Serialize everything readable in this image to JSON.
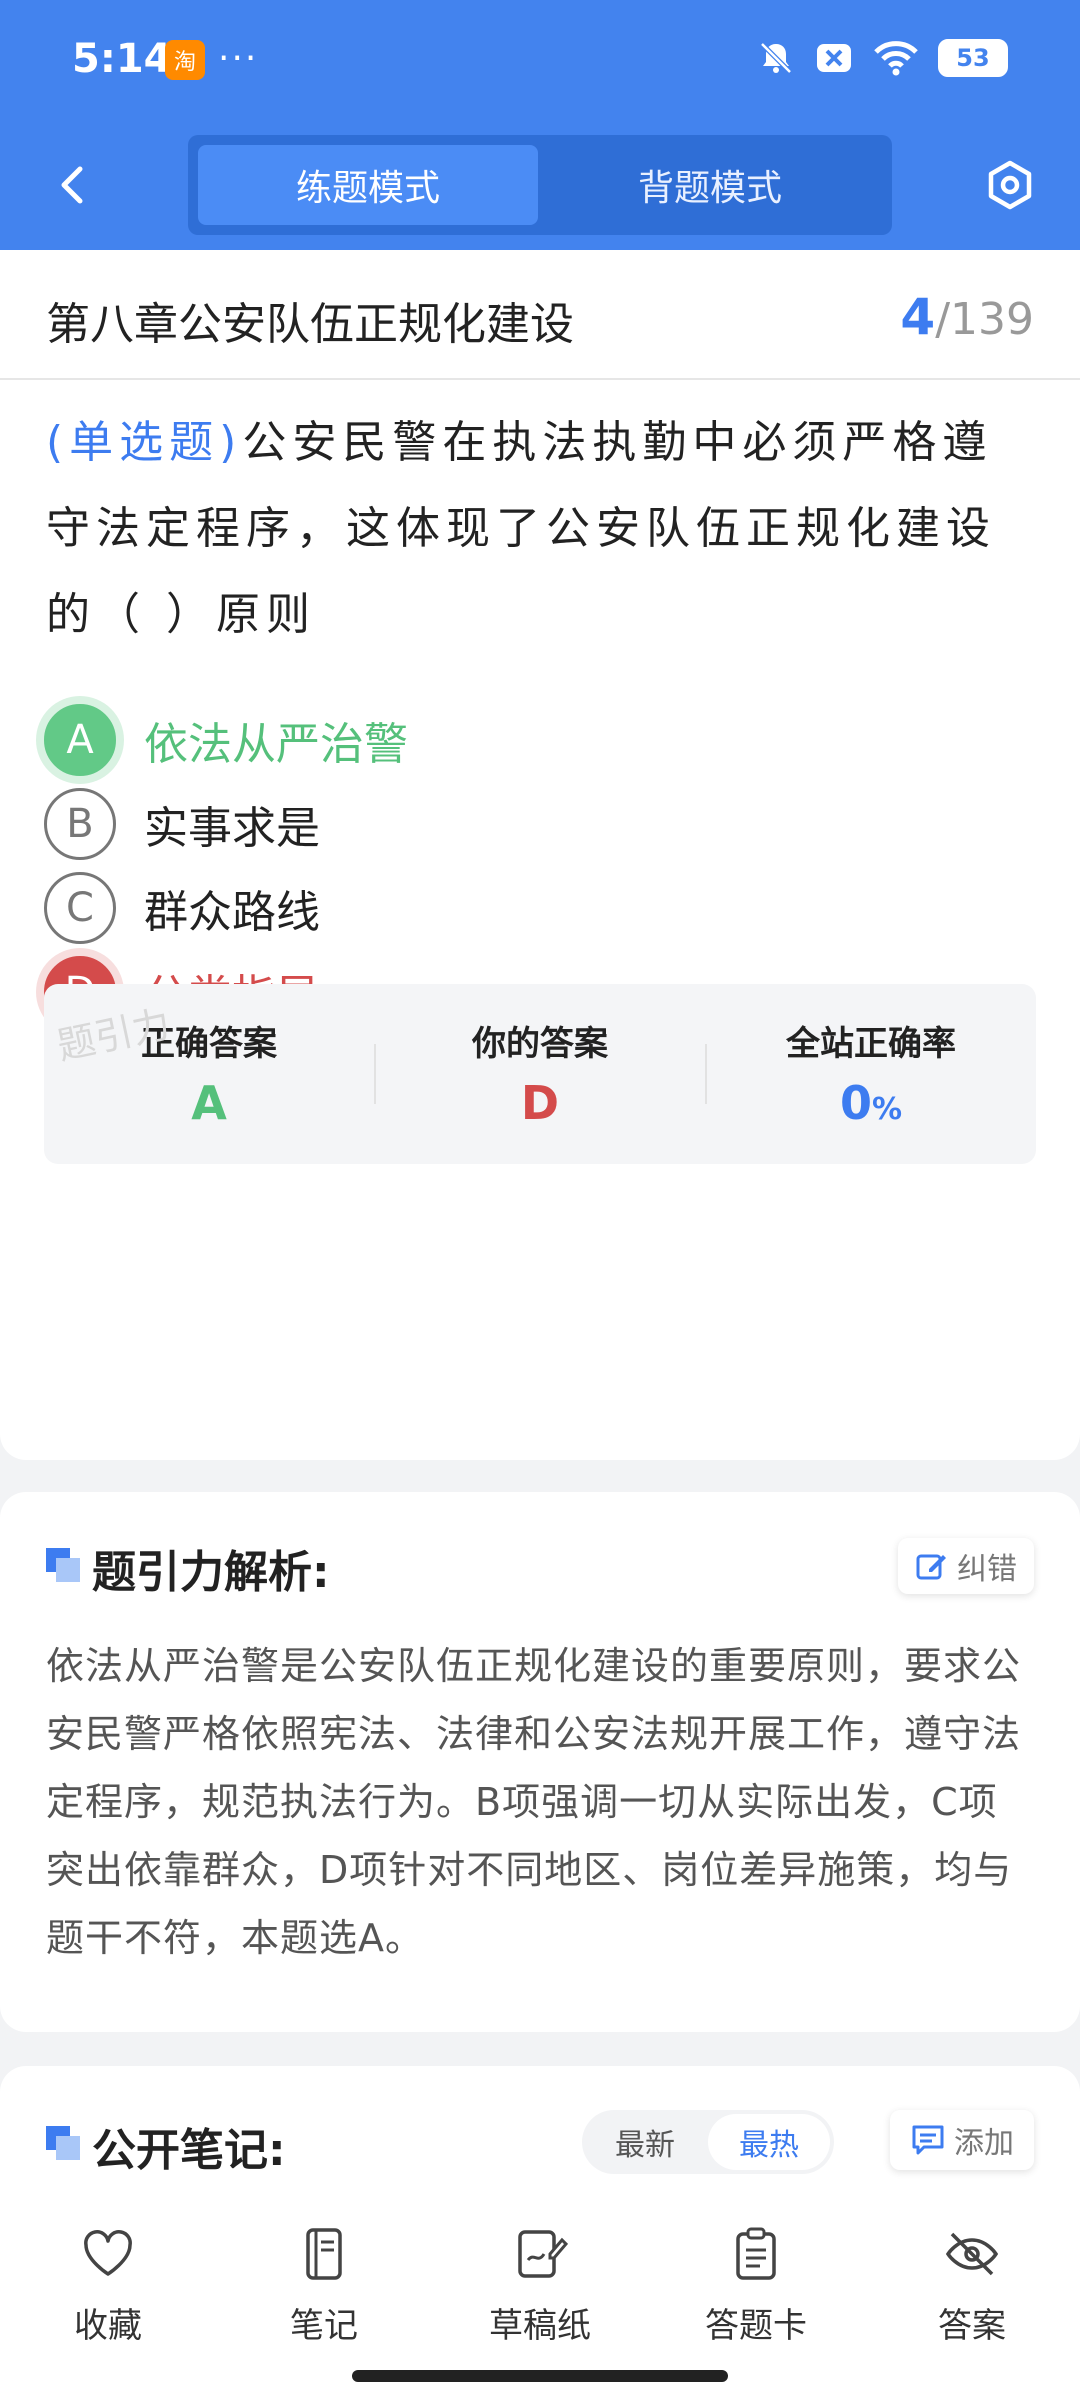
{
  "status_bar": {
    "time": "5:14",
    "app_badge": "淘",
    "more": "···",
    "battery": "53"
  },
  "nav": {
    "tabs": [
      "练题模式",
      "背题模式"
    ],
    "active_tab": 0
  },
  "question_header": {
    "chapter": "第八章公安队伍正规化建设",
    "current": "4",
    "total": "/139"
  },
  "question": {
    "type": "(单选题)",
    "text": "公安民警在执法执勤中必须严格遵守法定程序，这体现了公安队伍正规化建设的（        ）原则",
    "options": [
      {
        "letter": "A",
        "text": "依法从严治警",
        "state": "correct"
      },
      {
        "letter": "B",
        "text": "实事求是",
        "state": "normal"
      },
      {
        "letter": "C",
        "text": "群众路线",
        "state": "normal"
      },
      {
        "letter": "D",
        "text": "分类指导",
        "state": "wrong"
      }
    ]
  },
  "answer_summary": {
    "correct_label": "正确答案",
    "correct_value": "A",
    "yours_label": "你的答案",
    "yours_value": "D",
    "rate_label": "全站正确率",
    "rate_value": "0",
    "rate_unit": "%",
    "watermark": "题引力"
  },
  "analysis": {
    "title": "题引力解析:",
    "report_label": "纠错",
    "text": "依法从严治警是公安队伍正规化建设的重要原则，要求公安民警严格依照宪法、法律和公安法规开展工作，遵守法定程序，规范执法行为。B项强调一切从实际出发，C项突出依靠群众，D项针对不同地区、岗位差异施策，均与题干不符，本题选A。"
  },
  "notes": {
    "title": "公开笔记:",
    "sort_latest": "最新",
    "sort_hot": "最热",
    "add_label": "添加"
  },
  "tabbar": {
    "items": [
      "收藏",
      "笔记",
      "草稿纸",
      "答题卡",
      "答案"
    ]
  },
  "colors": {
    "primary": "#4383ee",
    "correct": "#55c07b",
    "wrong": "#d44b4b",
    "accent": "#3d7cf0"
  }
}
